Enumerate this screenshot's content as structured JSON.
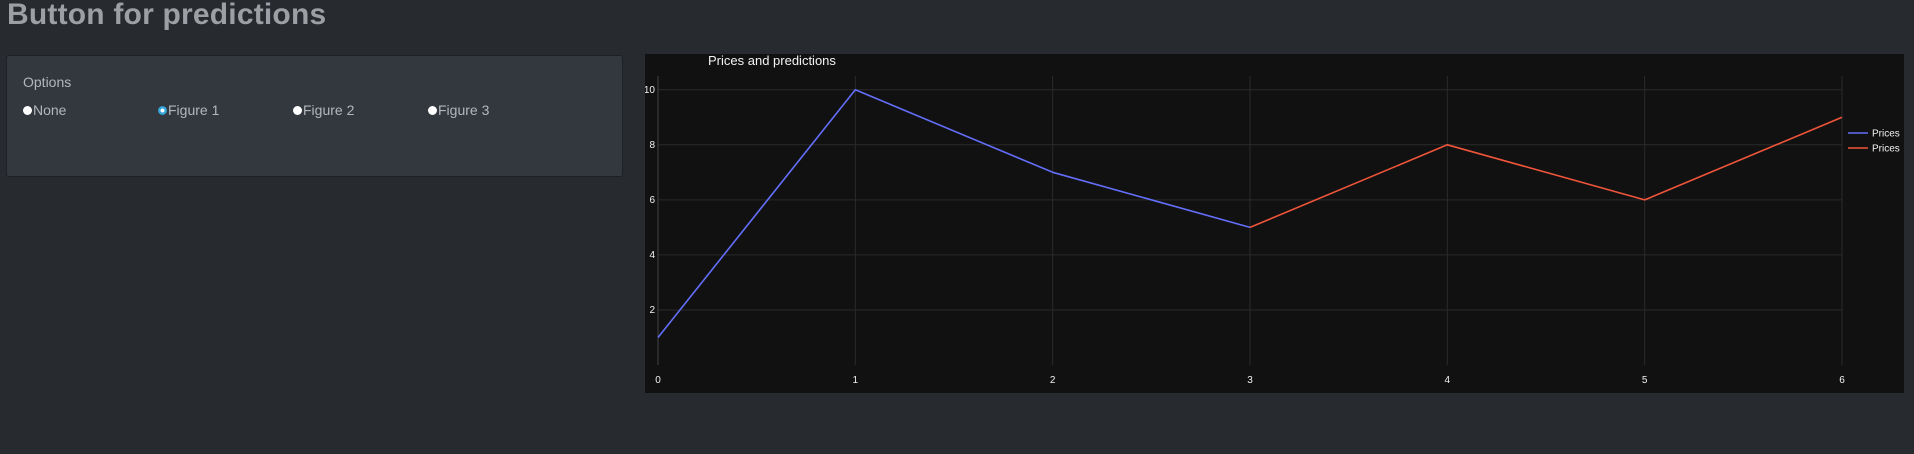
{
  "page": {
    "title": "Button for predictions"
  },
  "options": {
    "label": "Options",
    "items": [
      {
        "label": "None",
        "checked": false
      },
      {
        "label": "Figure 1",
        "checked": true
      },
      {
        "label": "Figure 2",
        "checked": false
      },
      {
        "label": "Figure 3",
        "checked": false
      }
    ]
  },
  "chart_data": {
    "type": "line",
    "title": "Prices and predictions",
    "xlabel": "",
    "ylabel": "",
    "xlim": [
      0,
      6
    ],
    "ylim": [
      0,
      10.5
    ],
    "x_ticks": [
      "0",
      "1",
      "2",
      "3",
      "4",
      "5",
      "6"
    ],
    "y_ticks": [
      "2",
      "4",
      "6",
      "8",
      "10"
    ],
    "grid": true,
    "legend_position": "right",
    "series": [
      {
        "name": "Prices",
        "color": "#636efa",
        "x": [
          0,
          1,
          2,
          3
        ],
        "y": [
          1,
          10,
          7,
          5
        ]
      },
      {
        "name": "Prices",
        "color": "#ef553b",
        "x": [
          3,
          4,
          5,
          6
        ],
        "y": [
          5,
          8,
          6,
          9
        ]
      }
    ]
  },
  "colors": {
    "background": "#272b30",
    "card": "#32383e",
    "chart_background": "#111111",
    "accent": "#2a9fd6",
    "title_text": "#9c9fa3"
  }
}
